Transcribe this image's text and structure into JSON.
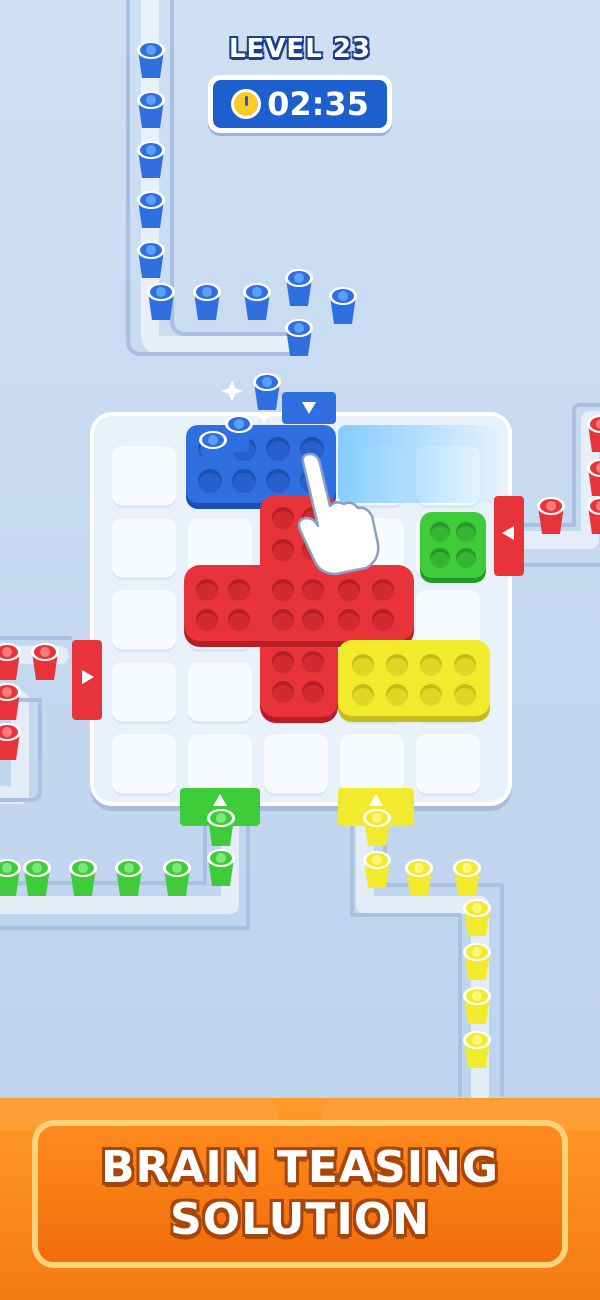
{
  "hud": {
    "level_label": "LEVEL 23",
    "timer": "02:35",
    "timer_icon": "stopwatch-icon"
  },
  "banner": {
    "line1": "BRAIN TEASING",
    "line2": "SOLUTION"
  },
  "colors": {
    "blue": "#2f6fe0",
    "red": "#e8333a",
    "green": "#3fcc3a",
    "yellow": "#f2ea2c",
    "orange_banner": "#f47a12",
    "track": "#b3c8e6"
  },
  "board": {
    "columns": 5,
    "rows": 5
  },
  "pieces": [
    {
      "name": "blue-piece",
      "color": "blue",
      "studs": 8
    },
    {
      "name": "red-cross-piece",
      "color": "red",
      "studs": 20
    },
    {
      "name": "green-piece",
      "color": "green",
      "studs": 4
    },
    {
      "name": "yellow-piece",
      "color": "yellow",
      "studs": 8
    }
  ],
  "gates": [
    {
      "name": "blue-gate",
      "color": "blue",
      "direction": "down"
    },
    {
      "name": "red-gate-right",
      "color": "red",
      "direction": "left"
    },
    {
      "name": "red-gate-left",
      "color": "red",
      "direction": "right"
    },
    {
      "name": "green-gate",
      "color": "green",
      "direction": "up"
    },
    {
      "name": "yellow-gate",
      "color": "yellow",
      "direction": "up"
    }
  ],
  "cup_icons": {
    "blue": "wifi-icon",
    "red": "star-icon",
    "green": "leaf-icon",
    "yellow": "coin-icon"
  }
}
